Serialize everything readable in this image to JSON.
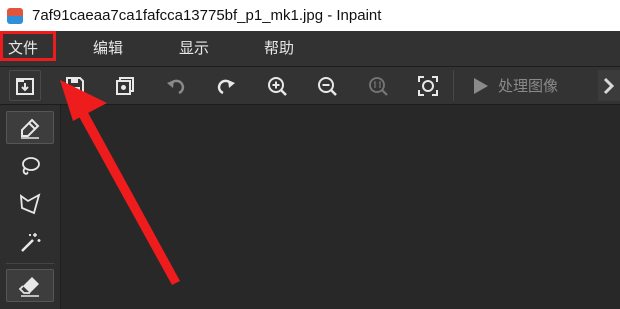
{
  "window": {
    "title": "7af91caeaa7ca1fafcca13775bf_p1_mk1.jpg - Inpaint"
  },
  "menu": {
    "items": [
      "文件",
      "编辑",
      "显示",
      "帮助"
    ]
  },
  "toolbar": {
    "icons": [
      "open-icon",
      "save-icon",
      "save-as-icon",
      "undo-icon",
      "redo-icon",
      "zoom-in-icon",
      "zoom-out-icon",
      "zoom-actual-icon",
      "zoom-fit-icon"
    ],
    "process_label": "处理图像"
  },
  "tools": {
    "icons": [
      "marker-icon",
      "lasso-icon",
      "polygon-lasso-icon",
      "magic-wand-icon",
      "eraser-icon"
    ],
    "active": "marker-icon"
  },
  "annotation": {
    "highlight_color": "#ee1c1c",
    "highlighted_item": "文件"
  }
}
